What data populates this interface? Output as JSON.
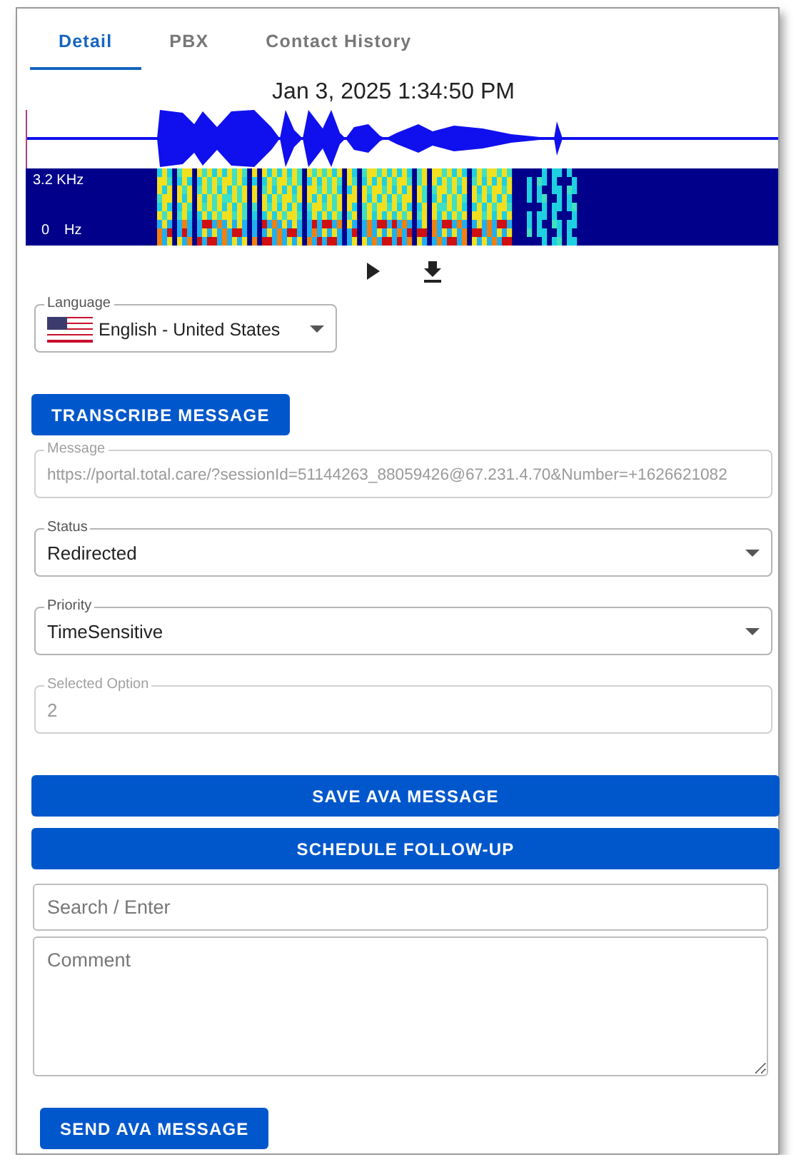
{
  "tabs": [
    {
      "label": "Detail",
      "selected": true
    },
    {
      "label": "PBX",
      "selected": false
    },
    {
      "label": "Contact History",
      "selected": false
    }
  ],
  "recording": {
    "timestamp": "Jan 3, 2025 1:34:50 PM",
    "top_label": "3.2 KHz",
    "bottom_value": "0",
    "bottom_unit": "Hz"
  },
  "language": {
    "label": "Language",
    "value": "English - United States"
  },
  "transcribe_button": "TRANSCRIBE MESSAGE",
  "fields": [
    {
      "kind": "text",
      "label": "Message",
      "value": "https://portal.total.care/?sessionId=51144263_88059426@67.231.4.70&Number=+1626621082",
      "disabled": true
    },
    {
      "kind": "select",
      "label": "Status",
      "value": "Redirected",
      "disabled": false
    },
    {
      "kind": "select",
      "label": "Priority",
      "value": "TimeSensitive",
      "disabled": false
    },
    {
      "kind": "text",
      "label": "Selected Option",
      "value": "2",
      "disabled": true
    }
  ],
  "action_buttons": [
    "SAVE AVA MESSAGE",
    "SCHEDULE FOLLOW-UP"
  ],
  "search": {
    "placeholder": "Search / Enter"
  },
  "comment": {
    "placeholder": "Comment"
  },
  "send_button": "SEND AVA MESSAGE"
}
